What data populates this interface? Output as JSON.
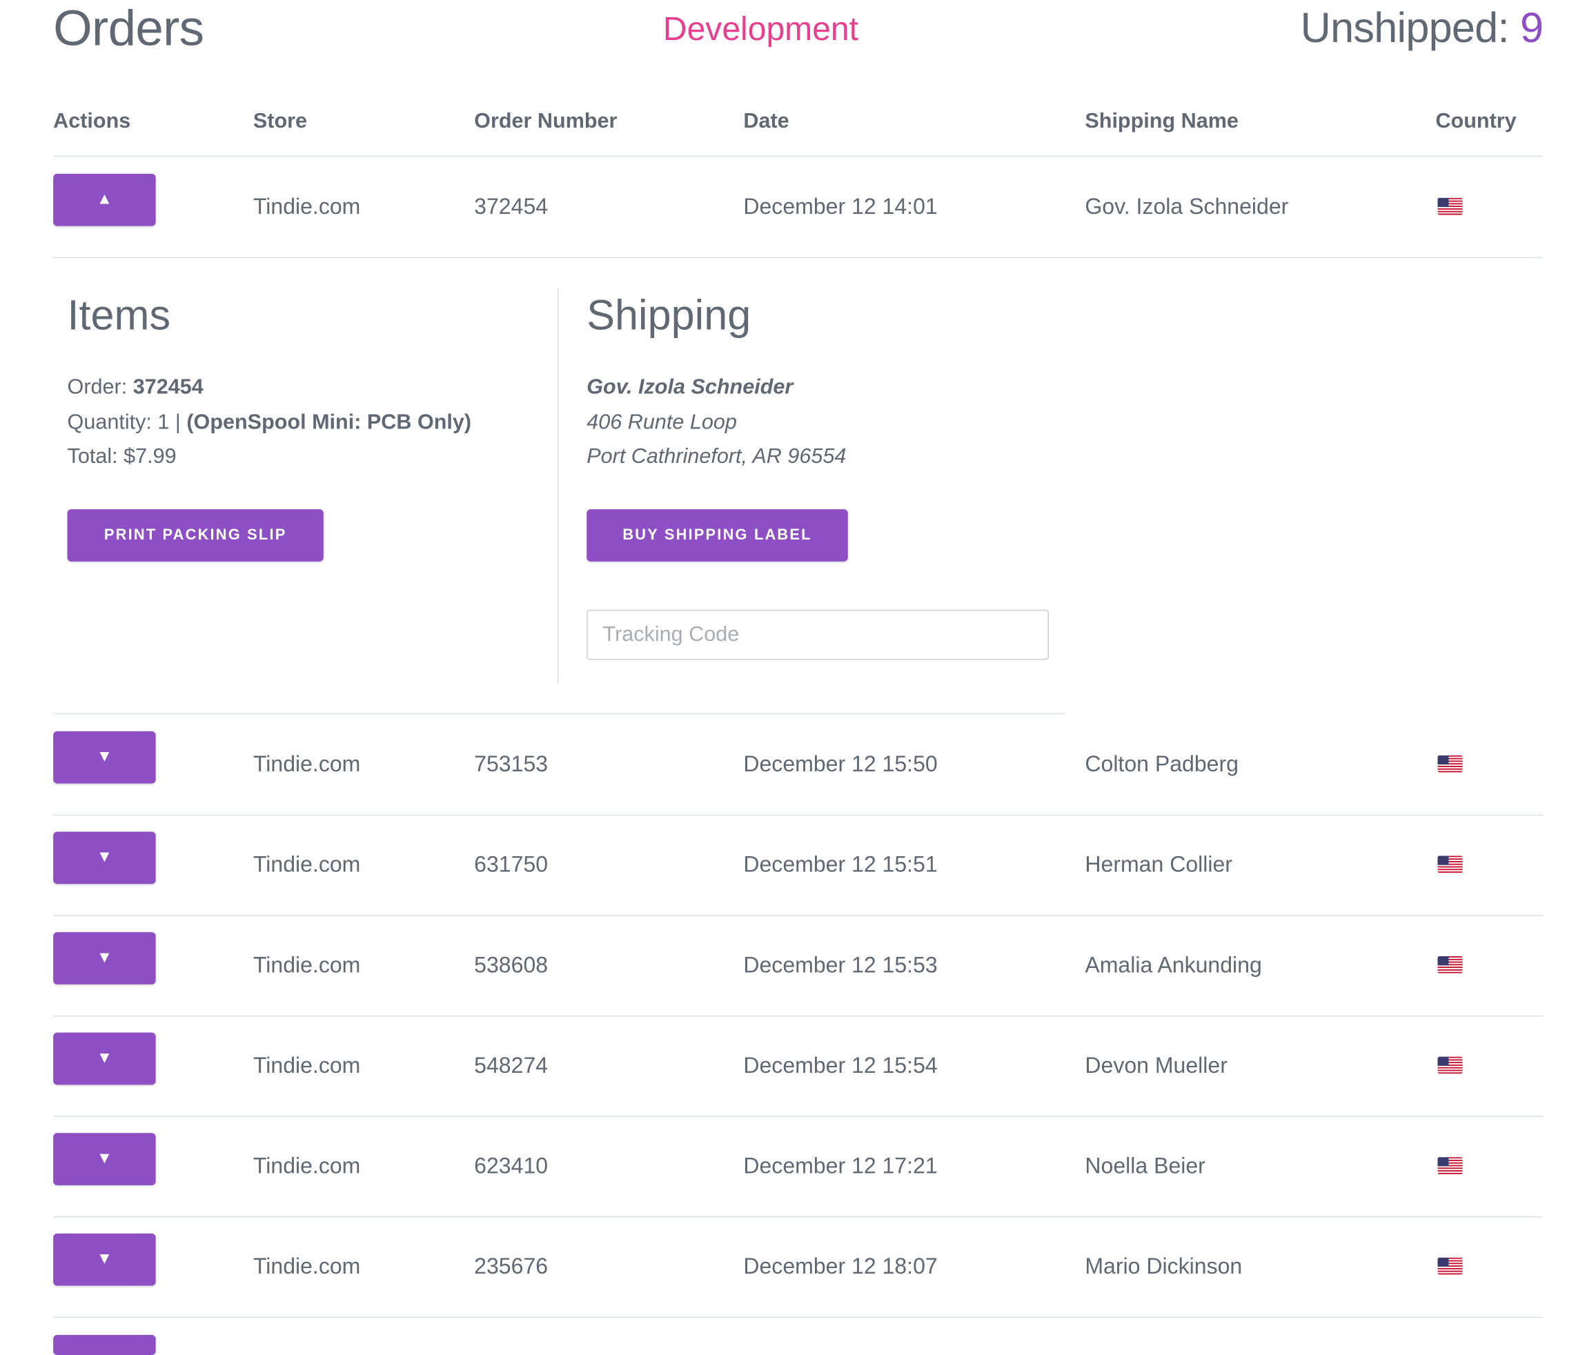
{
  "header": {
    "title": "Orders",
    "environment": "Development",
    "unshipped_label": "Unshipped:",
    "unshipped_count": "9"
  },
  "columns": {
    "actions": "Actions",
    "store": "Store",
    "order_number": "Order Number",
    "date": "Date",
    "shipping_name": "Shipping Name",
    "country": "Country"
  },
  "expanded_order": {
    "toggle_icon": "▲",
    "store": "Tindie.com",
    "order_number": "372454",
    "date": "December 12 14:01",
    "shipping_name": "Gov. Izola Schneider",
    "country_flag": "us-flag-icon",
    "items": {
      "title": "Items",
      "order_label": "Order:",
      "order_value": "372454",
      "quantity_label": "Quantity: 1 |",
      "quantity_product": "(OpenSpool Mini: PCB Only)",
      "total": "Total: $7.99",
      "print_button": "PRINT PACKING SLIP"
    },
    "shipping": {
      "title": "Shipping",
      "name": "Gov. Izola Schneider",
      "address_line1": "406 Runte Loop",
      "address_line2": "Port Cathrinefort, AR 96554",
      "buy_button": "BUY SHIPPING LABEL",
      "tracking_placeholder": "Tracking Code"
    }
  },
  "orders": [
    {
      "toggle_icon": "▼",
      "store": "Tindie.com",
      "order_number": "753153",
      "date": "December 12 15:50",
      "shipping_name": "Colton Padberg",
      "country_flag": "us-flag-icon"
    },
    {
      "toggle_icon": "▼",
      "store": "Tindie.com",
      "order_number": "631750",
      "date": "December 12 15:51",
      "shipping_name": "Herman Collier",
      "country_flag": "us-flag-icon"
    },
    {
      "toggle_icon": "▼",
      "store": "Tindie.com",
      "order_number": "538608",
      "date": "December 12 15:53",
      "shipping_name": "Amalia Ankunding",
      "country_flag": "us-flag-icon"
    },
    {
      "toggle_icon": "▼",
      "store": "Tindie.com",
      "order_number": "548274",
      "date": "December 12 15:54",
      "shipping_name": "Devon Mueller",
      "country_flag": "us-flag-icon"
    },
    {
      "toggle_icon": "▼",
      "store": "Tindie.com",
      "order_number": "623410",
      "date": "December 12 17:21",
      "shipping_name": "Noella Beier",
      "country_flag": "us-flag-icon"
    },
    {
      "toggle_icon": "▼",
      "store": "Tindie.com",
      "order_number": "235676",
      "date": "December 12 18:07",
      "shipping_name": "Mario Dickinson",
      "country_flag": "us-flag-icon"
    }
  ],
  "colors": {
    "accent": "#8f4fc4",
    "environment": "#e63f8f",
    "text": "#5f6873",
    "divider": "#dcdfe3"
  }
}
